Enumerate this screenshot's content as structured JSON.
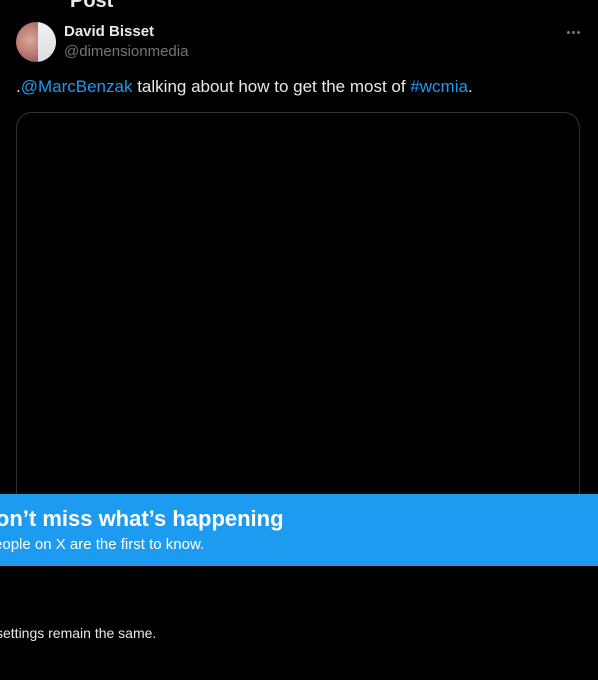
{
  "post": {
    "header_fragment": "Post",
    "author": {
      "name": "David Bisset",
      "handle": "@dimensionmedia"
    },
    "text": {
      "prefix": ".",
      "mention": "@MarcBenzak",
      "middle": " talking about how to get the most of ",
      "hashtag": "#wcmia",
      "suffix": "."
    }
  },
  "banner": {
    "title": "Don’t miss what’s happening",
    "subtitle": "People on X are the first to know."
  },
  "footer": {
    "note": "settings remain the same."
  },
  "colors": {
    "background": "#000000",
    "accent": "#1d9bf0",
    "muted": "#71767b",
    "text": "#e7e9ea",
    "border": "#2f3336"
  }
}
